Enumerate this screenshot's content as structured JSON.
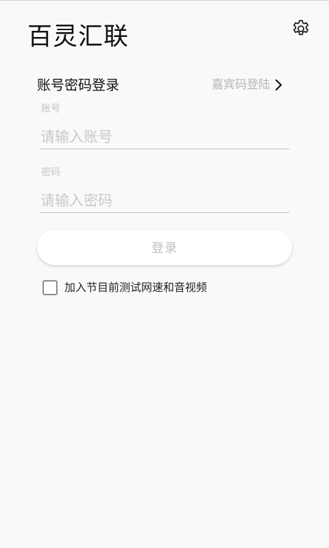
{
  "app": {
    "title": "百灵汇联"
  },
  "header": {
    "settings_icon": "gear-icon"
  },
  "login": {
    "mode_title": "账号密码登录",
    "guest_link_label": "嘉宾码登陆",
    "guest_link_icon": "chevron-right-icon",
    "account": {
      "label": "账号",
      "placeholder": "请输入账号",
      "value": ""
    },
    "password": {
      "label": "密码",
      "placeholder": "请输入密码",
      "value": ""
    },
    "submit_label": "登录",
    "test_option": {
      "label": "加入节目前测试网速和音视频",
      "checked": false
    }
  },
  "colors": {
    "background": "#f9f9f9",
    "muted_text": "#b5b5b5",
    "divider": "#bdbdbd"
  }
}
